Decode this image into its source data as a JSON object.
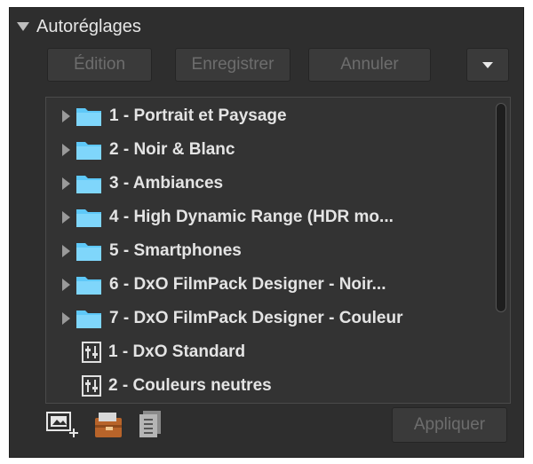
{
  "panel": {
    "title": "Autoréglages"
  },
  "toolbar": {
    "edit_label": "Édition",
    "save_label": "Enregistrer",
    "cancel_label": "Annuler"
  },
  "presets": {
    "folders": [
      {
        "label": "1 - Portrait et Paysage"
      },
      {
        "label": "2 - Noir & Blanc"
      },
      {
        "label": "3 - Ambiances"
      },
      {
        "label": "4 - High Dynamic Range (HDR mo..."
      },
      {
        "label": "5 - Smartphones"
      },
      {
        "label": "6 - DxO FilmPack Designer - Noir..."
      },
      {
        "label": "7 - DxO FilmPack Designer - Couleur"
      }
    ],
    "items": [
      {
        "label": "1 - DxO Standard"
      },
      {
        "label": "2 - Couleurs neutres"
      }
    ]
  },
  "footer": {
    "apply_label": "Appliquer",
    "icons": [
      "new-preset-icon",
      "import-preset-icon",
      "export-preset-icon"
    ]
  },
  "colors": {
    "folder": "#5ec8f8",
    "panel_bg": "#2e2e2e",
    "text": "#e4e4e4",
    "disabled_text": "#6d6d6d"
  }
}
